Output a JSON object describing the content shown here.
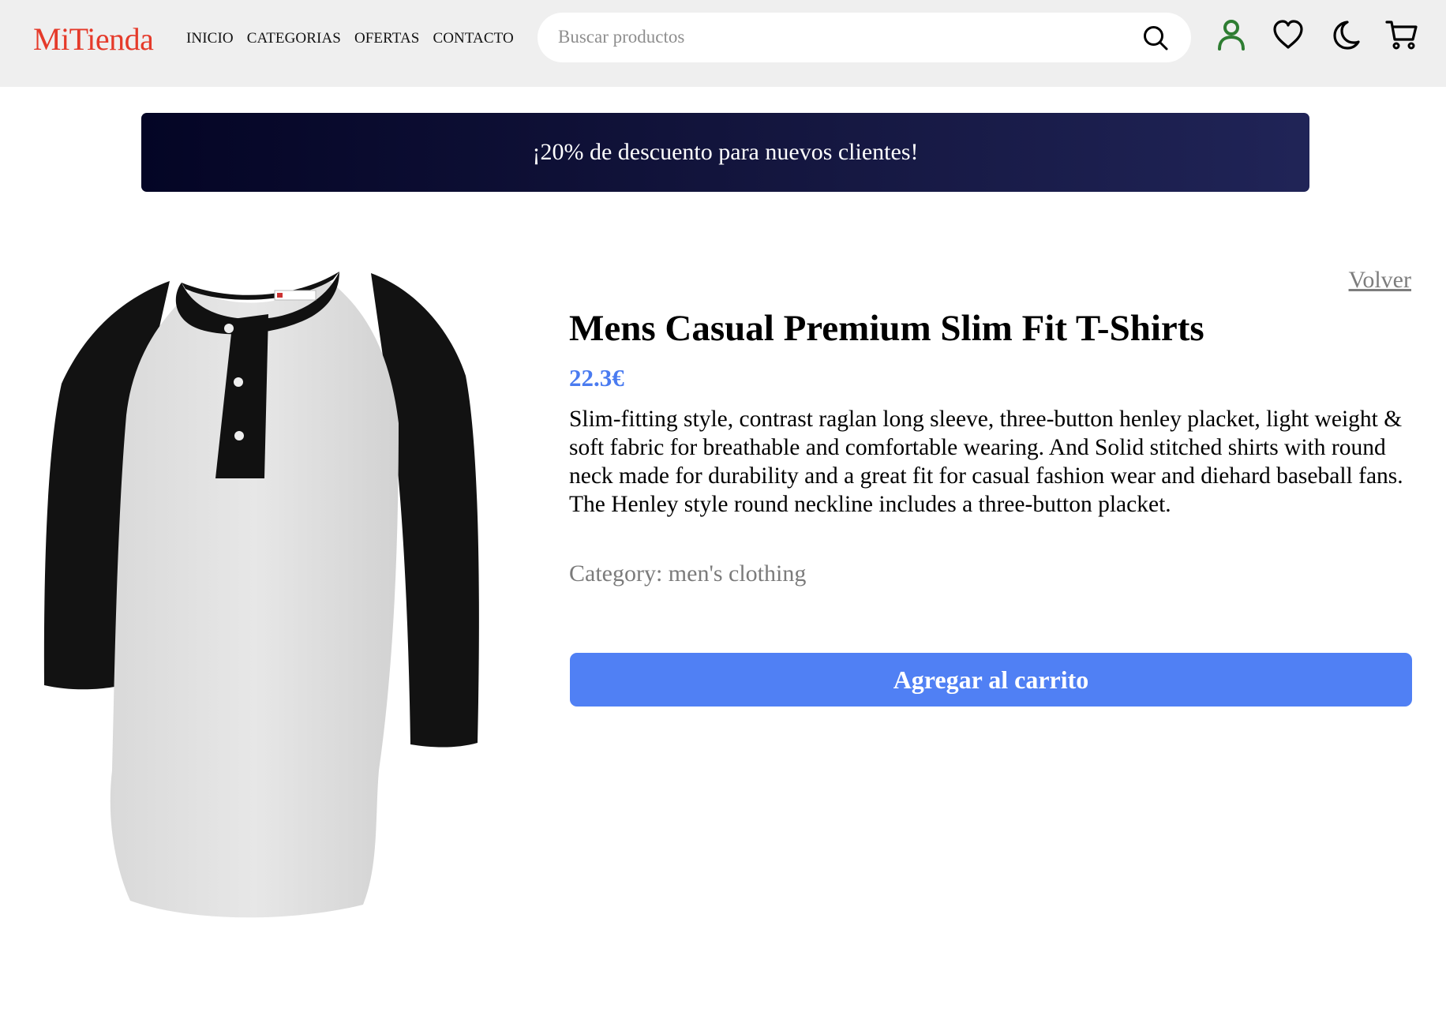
{
  "header": {
    "logo": "MiTienda",
    "nav": [
      "INICIO",
      "CATEGORIAS",
      "OFERTAS",
      "CONTACTO"
    ],
    "search_placeholder": "Buscar productos",
    "icons": [
      "search-icon",
      "user-icon",
      "heart-icon",
      "moon-icon",
      "cart-icon"
    ]
  },
  "banner": {
    "text": "¡20% de descuento para nuevos clientes!"
  },
  "product": {
    "back_label": "Volver",
    "title": "Mens Casual Premium Slim Fit T-Shirts",
    "price": "22.3€",
    "description": "Slim-fitting style, contrast raglan long sleeve, three-button henley placket, light weight & soft fabric for breathable and comfortable wearing. And Solid stitched shirts with round neck made for durability and a great fit for casual fashion wear and diehard baseball fans. The Henley style round neckline includes a three-button placket.",
    "category": "Category: men's clothing",
    "add_to_cart_label": "Agregar al carrito",
    "image": "henley-raglan-shirt"
  },
  "colors": {
    "logo": "#e53a2a",
    "user_icon": "#2e7d32",
    "price": "#4a7bf0",
    "button": "#5080f4",
    "banner_start": "#040525",
    "banner_end": "#202457",
    "header_bg": "#efefef"
  }
}
